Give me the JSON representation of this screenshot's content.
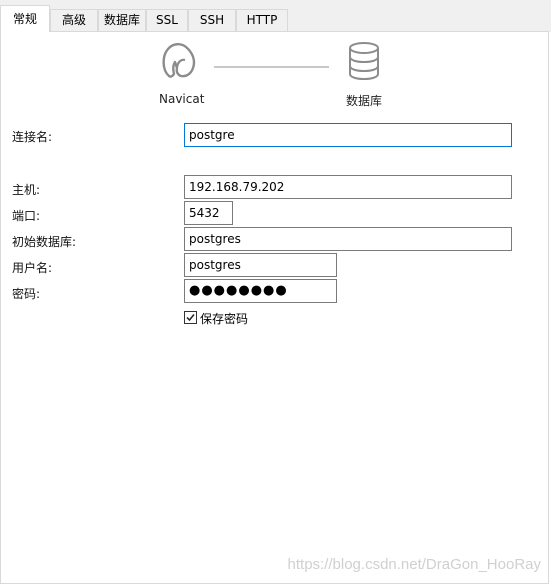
{
  "tabs": [
    "常规",
    "高级",
    "数据库",
    "SSL",
    "SSH",
    "HTTP"
  ],
  "active_tab": "常规",
  "diagram": {
    "left_label": "Navicat",
    "left_icon": "navicat-logo-icon",
    "right_label": "数据库",
    "right_icon": "database-icon"
  },
  "form": {
    "connection_name": {
      "label": "连接名:",
      "value": "postgre"
    },
    "host": {
      "label": "主机:",
      "value": "192.168.79.202"
    },
    "port": {
      "label": "端口:",
      "value": "5432"
    },
    "initial_db": {
      "label": "初始数据库:",
      "value": "postgres"
    },
    "username": {
      "label": "用户名:",
      "value": "postgres"
    },
    "password": {
      "label": "密码:",
      "value": "●●●●●●●●"
    },
    "save_password": {
      "label": "保存密码",
      "checked": true
    }
  },
  "watermark": "https://blog.csdn.net/DraGon_HooRay",
  "colors": {
    "focus_border": "#0078d7",
    "tab_bg": "#f0f0f0",
    "border": "#d9d9d9"
  }
}
